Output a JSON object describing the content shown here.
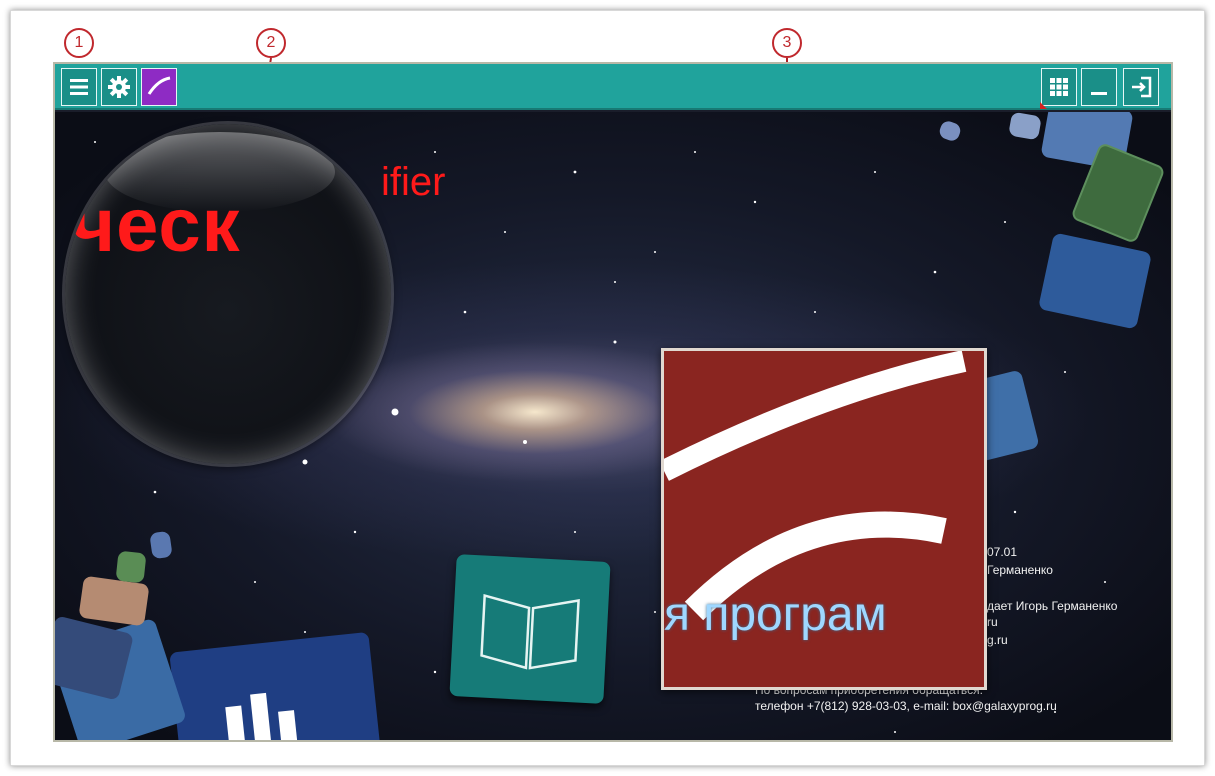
{
  "callouts": {
    "first": "1",
    "second": "2",
    "third": "3"
  },
  "toolbar": {
    "left_icons": [
      "menu-icon",
      "gear-icon",
      "app-logo-icon"
    ],
    "right_icons": [
      "grid-icon",
      "minimize-icon",
      "exit-icon"
    ]
  },
  "magnifier": {
    "text": "ческ"
  },
  "title_fragment": "ifier",
  "zoom": {
    "text": "я програм"
  },
  "info": {
    "line1": "07.01",
    "line2": "Германенко",
    "line3": "дает Игорь Германенко",
    "line4": "ru",
    "line5": "g.ru",
    "contact_heading": "По вопросам приобретения обращаться:",
    "contact_line": "телефон +7(812) 928-03-03, e-mail: box@galaxyprog.ru"
  },
  "colors": {
    "titlebar": "#20a39c",
    "callout": "#c0282d",
    "magnifier_text": "#ff1a1a"
  }
}
